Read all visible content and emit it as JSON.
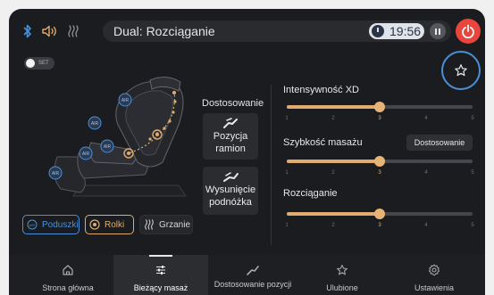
{
  "status_bar": {
    "mode_title": "Dual: Rozciąganie",
    "timer": "19:56",
    "icons": [
      "bluetooth-icon",
      "speaker-icon",
      "heat-wave-icon",
      "pause-icon",
      "power-icon"
    ]
  },
  "set_toggle": {
    "label": "SET",
    "on": false
  },
  "chair": {
    "air_badges": [
      "AIR",
      "AIR",
      "AIR",
      "AIR",
      "AIR"
    ]
  },
  "massage_modes": [
    {
      "label": "Poduszki",
      "icon": "AIR",
      "color": "#4a90d9"
    },
    {
      "label": "Rolki",
      "icon": "roller-icon",
      "color": "#e0ab6e"
    },
    {
      "label": "Grzanie",
      "icon": "heat-wave-icon",
      "color": "#c9cacd"
    }
  ],
  "adjust": {
    "heading": "Dostosowanie",
    "cards": [
      {
        "label": "Pozycja ramion"
      },
      {
        "label": "Wysunięcie podnóżka"
      }
    ]
  },
  "sliders": [
    {
      "title": "Intensywność XD",
      "value": 3,
      "min": 1,
      "max": 5,
      "ticks": [
        "1",
        "2",
        "3",
        "4",
        "5"
      ]
    },
    {
      "title": "Szybkość masażu",
      "value": 3,
      "min": 1,
      "max": 5,
      "ticks": [
        "1",
        "2",
        "3",
        "4",
        "5"
      ],
      "button": "Dostosowanie"
    },
    {
      "title": "Rozciąganie",
      "value": 3,
      "min": 1,
      "max": 5,
      "ticks": [
        "1",
        "2",
        "3",
        "4",
        "5"
      ]
    }
  ],
  "nav": [
    {
      "label": "Strona główna",
      "icon": "home-icon",
      "active": false
    },
    {
      "label": "Bieżący masaż",
      "icon": "sliders-icon",
      "active": true
    },
    {
      "label": "Dostosowanie pozycji",
      "icon": "chair-position-icon",
      "active": false
    },
    {
      "label": "Ulubione",
      "icon": "star-icon",
      "active": false
    },
    {
      "label": "Ustawienia",
      "icon": "gear-icon",
      "active": false
    }
  ],
  "colors": {
    "accent": "#e0ab6e",
    "blue": "#4a90d9",
    "power": "#e8453c",
    "background": "#1b1c1f"
  }
}
